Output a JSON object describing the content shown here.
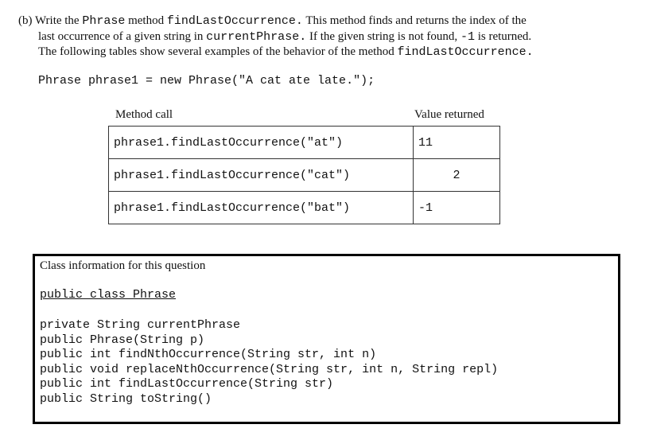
{
  "intro": {
    "line1": [
      "(b) Write the ",
      "Phrase",
      " method ",
      "findLastOccurrence.",
      " This method finds and returns the index of the"
    ],
    "line2": [
      "last occurrence of a given string in ",
      "currentPhrase.",
      " If the given string is not found, ",
      "-1",
      " is returned."
    ],
    "line3": [
      "The following tables show several examples of the behavior of the method ",
      "findLastOccurrence."
    ]
  },
  "declaration": "Phrase phrase1 = new Phrase(\"A cat ate late.\");",
  "table": {
    "headers": {
      "method": "Method call",
      "value": "Value returned"
    },
    "rows": [
      {
        "call": "phrase1.findLastOccurrence(\"at\")",
        "value": "11"
      },
      {
        "call": "phrase1.findLastOccurrence(\"cat\")",
        "value": "2"
      },
      {
        "call": "phrase1.findLastOccurrence(\"bat\")",
        "value": "-1"
      }
    ]
  },
  "class_info": {
    "title": "Class information for this question",
    "class_declaration": "public class Phrase",
    "members": [
      "private String currentPhrase",
      "public Phrase(String p)",
      "public int findNthOccurrence(String str, int n)",
      "public void replaceNthOccurrence(String str, int n, String repl)",
      "public int findLastOccurrence(String str)",
      "public String toString()"
    ]
  }
}
